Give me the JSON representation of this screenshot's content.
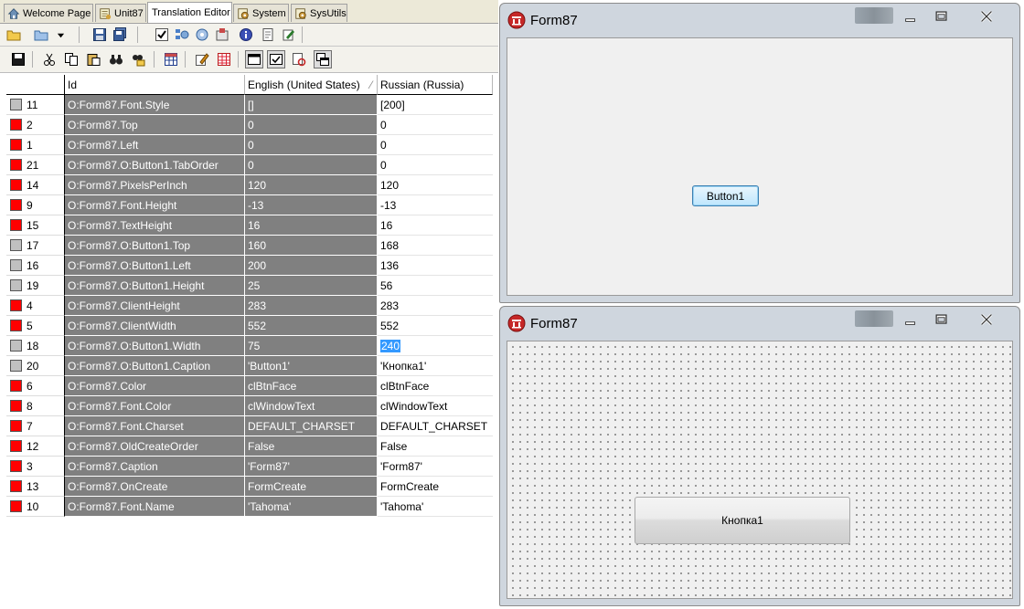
{
  "tabs": [
    {
      "label": "Welcome Page",
      "icon": "home-icon",
      "active": false
    },
    {
      "label": "Unit87",
      "icon": "unit-icon",
      "active": false
    },
    {
      "label": "Translation Editor",
      "icon": "",
      "active": true
    },
    {
      "label": "System",
      "icon": "unit-gear-icon",
      "active": false
    },
    {
      "label": "SysUtils",
      "icon": "unit-gear-icon",
      "active": false
    }
  ],
  "grid": {
    "columns": [
      "",
      "Id",
      "English (United States)",
      "Russian (Russia)"
    ],
    "rows": [
      {
        "num": "11",
        "status": "gray",
        "id": "O:Form87.Font.Style",
        "english": "[]",
        "russian": "[200]"
      },
      {
        "num": "2",
        "status": "red",
        "id": "O:Form87.Top",
        "english": "0",
        "russian": "0"
      },
      {
        "num": "1",
        "status": "red",
        "id": "O:Form87.Left",
        "english": "0",
        "russian": "0"
      },
      {
        "num": "21",
        "status": "red",
        "id": "O:Form87.O:Button1.TabOrder",
        "english": "0",
        "russian": "0"
      },
      {
        "num": "14",
        "status": "red",
        "id": "O:Form87.PixelsPerInch",
        "english": "120",
        "russian": "120"
      },
      {
        "num": "9",
        "status": "red",
        "id": "O:Form87.Font.Height",
        "english": "-13",
        "russian": "-13"
      },
      {
        "num": "15",
        "status": "red",
        "id": "O:Form87.TextHeight",
        "english": "16",
        "russian": "16"
      },
      {
        "num": "17",
        "status": "gray",
        "id": "O:Form87.O:Button1.Top",
        "english": "160",
        "russian": "168"
      },
      {
        "num": "16",
        "status": "gray",
        "id": "O:Form87.O:Button1.Left",
        "english": "200",
        "russian": "136"
      },
      {
        "num": "19",
        "status": "gray",
        "id": "O:Form87.O:Button1.Height",
        "english": "25",
        "russian": "56"
      },
      {
        "num": "4",
        "status": "red",
        "id": "O:Form87.ClientHeight",
        "english": "283",
        "russian": "283"
      },
      {
        "num": "5",
        "status": "red",
        "id": "O:Form87.ClientWidth",
        "english": "552",
        "russian": "552"
      },
      {
        "num": "18",
        "status": "gray",
        "id": "O:Form87.O:Button1.Width",
        "english": "75",
        "russian": "240",
        "selected": true
      },
      {
        "num": "20",
        "status": "gray",
        "id": "O:Form87.O:Button1.Caption",
        "english": "'Button1'",
        "russian": "'Кнопка1'"
      },
      {
        "num": "6",
        "status": "red",
        "id": "O:Form87.Color",
        "english": "clBtnFace",
        "russian": "clBtnFace"
      },
      {
        "num": "8",
        "status": "red",
        "id": "O:Form87.Font.Color",
        "english": "clWindowText",
        "russian": "clWindowText"
      },
      {
        "num": "7",
        "status": "red",
        "id": "O:Form87.Font.Charset",
        "english": "DEFAULT_CHARSET",
        "russian": "DEFAULT_CHARSET"
      },
      {
        "num": "12",
        "status": "red",
        "id": "O:Form87.OldCreateOrder",
        "english": "False",
        "russian": "False"
      },
      {
        "num": "3",
        "status": "red",
        "id": "O:Form87.Caption",
        "english": "'Form87'",
        "russian": "'Form87'"
      },
      {
        "num": "13",
        "status": "red",
        "id": "O:Form87.OnCreate",
        "english": "FormCreate",
        "russian": "FormCreate"
      },
      {
        "num": "10",
        "status": "red",
        "id": "O:Form87.Font.Name",
        "english": "'Tahoma'",
        "russian": "'Tahoma'"
      }
    ]
  },
  "form_top": {
    "title": "Form87",
    "button_label": "Button1"
  },
  "form_bottom": {
    "title": "Form87",
    "button_label": "Кнопка1"
  },
  "colors": {
    "status_red": "#ff0000",
    "status_gray": "#c0c0c0",
    "cell_gray": "#808080",
    "selection": "#3399ff"
  }
}
